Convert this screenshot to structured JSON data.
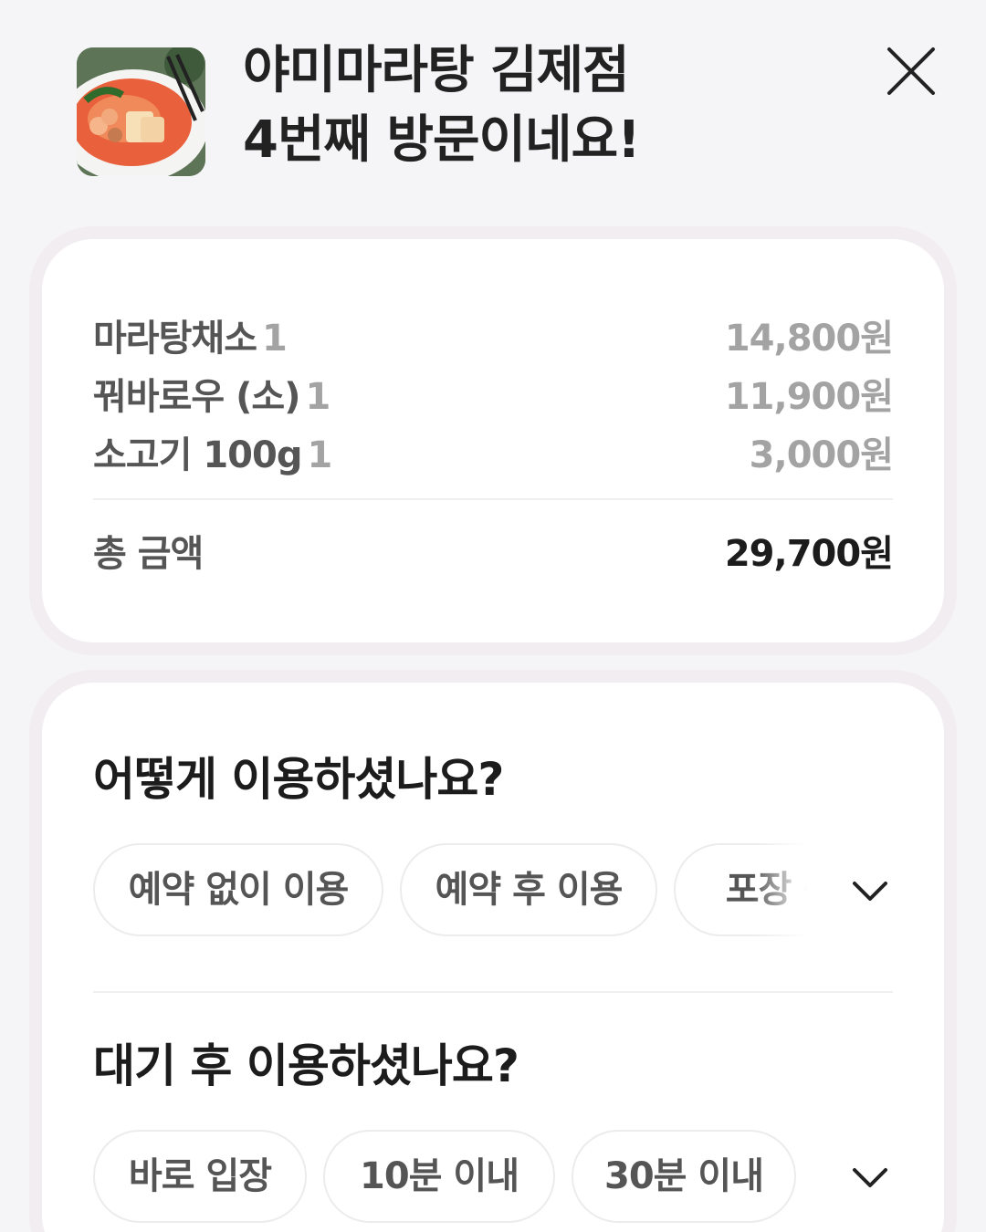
{
  "header": {
    "store_name": "야미마라탕 김제점",
    "visit_message": "4번째 방문이네요!",
    "thumbnail_icon": "mala-soup-photo",
    "close_icon": "close-icon"
  },
  "receipt": {
    "items": [
      {
        "name": "마라탕채소",
        "qty": "1",
        "price": "14,800원"
      },
      {
        "name": "꿔바로우 (소)",
        "qty": "1",
        "price": "11,900원"
      },
      {
        "name": "소고기 100g",
        "qty": "1",
        "price": "3,000원"
      }
    ],
    "total_label": "총 금액",
    "total_value": "29,700원"
  },
  "survey": {
    "usage_question": "어떻게 이용하셨나요?",
    "usage_options": [
      "예약 없이 이용",
      "예약 후 이용",
      "포장・배"
    ],
    "wait_question": "대기 후 이용하셨나요?",
    "wait_options": [
      "바로 입장",
      "10분 이내",
      "30분 이내"
    ],
    "expand_icon": "chevron-down-icon"
  },
  "colors": {
    "background": "#f5f4f6",
    "card": "#ffffff",
    "text_primary": "#1c1c1c",
    "text_secondary": "#555555",
    "text_muted": "#a3a3a3",
    "chip_border": "#ececec"
  }
}
